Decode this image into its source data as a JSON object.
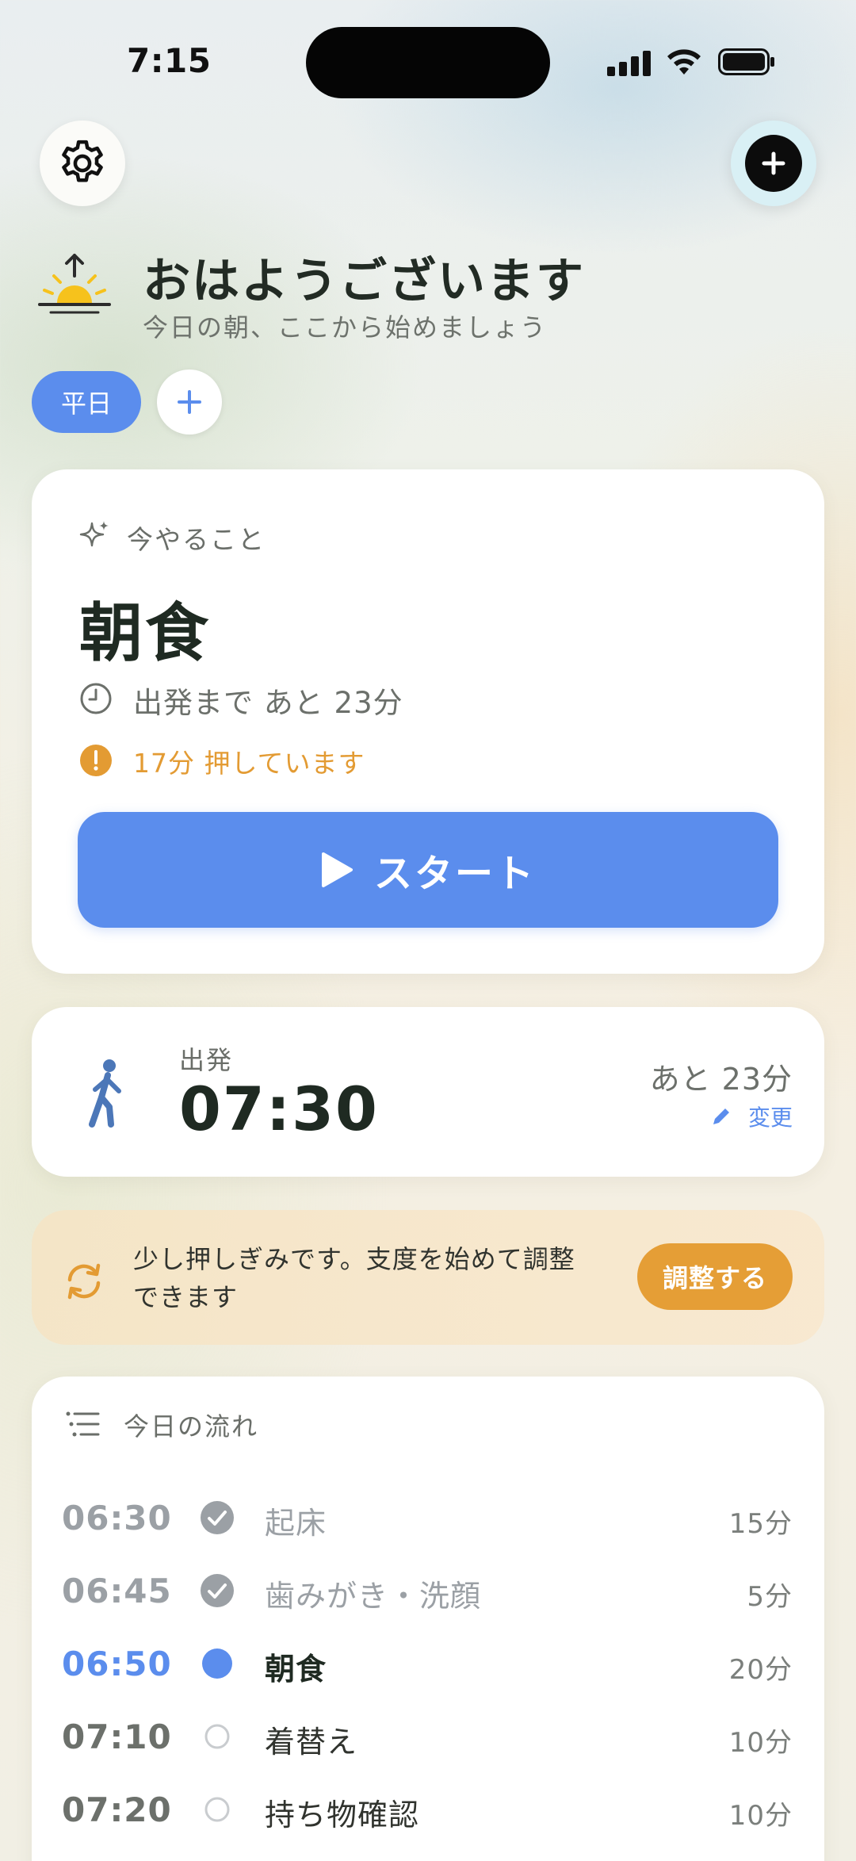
{
  "status_bar": {
    "time": "7:15"
  },
  "header": {
    "greeting": "おはようございます",
    "subtitle": "今日の朝、ここから始めましょう"
  },
  "chips": {
    "selected": "平日"
  },
  "now_card": {
    "label": "今やること",
    "task": "朝食",
    "until_departure": "出発まで あと 23分",
    "late_notice": "17分 押しています",
    "start_label": "スタート"
  },
  "departure": {
    "label": "出発",
    "time": "07:30",
    "remaining": "あと 23分",
    "edit_label": "変更"
  },
  "notice": {
    "text": "少し押しぎみです。支度を始めて調整できます",
    "action_label": "調整する"
  },
  "flow": {
    "title": "今日の流れ",
    "items": [
      {
        "time": "06:30",
        "name": "起床",
        "duration": "15分",
        "state": "done"
      },
      {
        "time": "06:45",
        "name": "歯みがき・洗顔",
        "duration": "5分",
        "state": "done"
      },
      {
        "time": "06:50",
        "name": "朝食",
        "duration": "20分",
        "state": "current"
      },
      {
        "time": "07:10",
        "name": "着替え",
        "duration": "10分",
        "state": "todo"
      },
      {
        "time": "07:20",
        "name": "持ち物確認",
        "duration": "10分",
        "state": "todo"
      }
    ]
  },
  "colors": {
    "accent": "#5b8ded",
    "warning": "#e39b33",
    "done": "#9ba0a5"
  },
  "icons": {
    "settings": "gear-icon",
    "add": "plus-circle-icon",
    "greeting": "sunrise-icon",
    "now": "sparkle-icon",
    "clock": "clock-icon",
    "warning": "exclamation-icon",
    "start": "play-icon",
    "departure": "walking-person-icon",
    "edit": "pencil-icon",
    "notice": "refresh-icon",
    "flow": "list-icon"
  }
}
